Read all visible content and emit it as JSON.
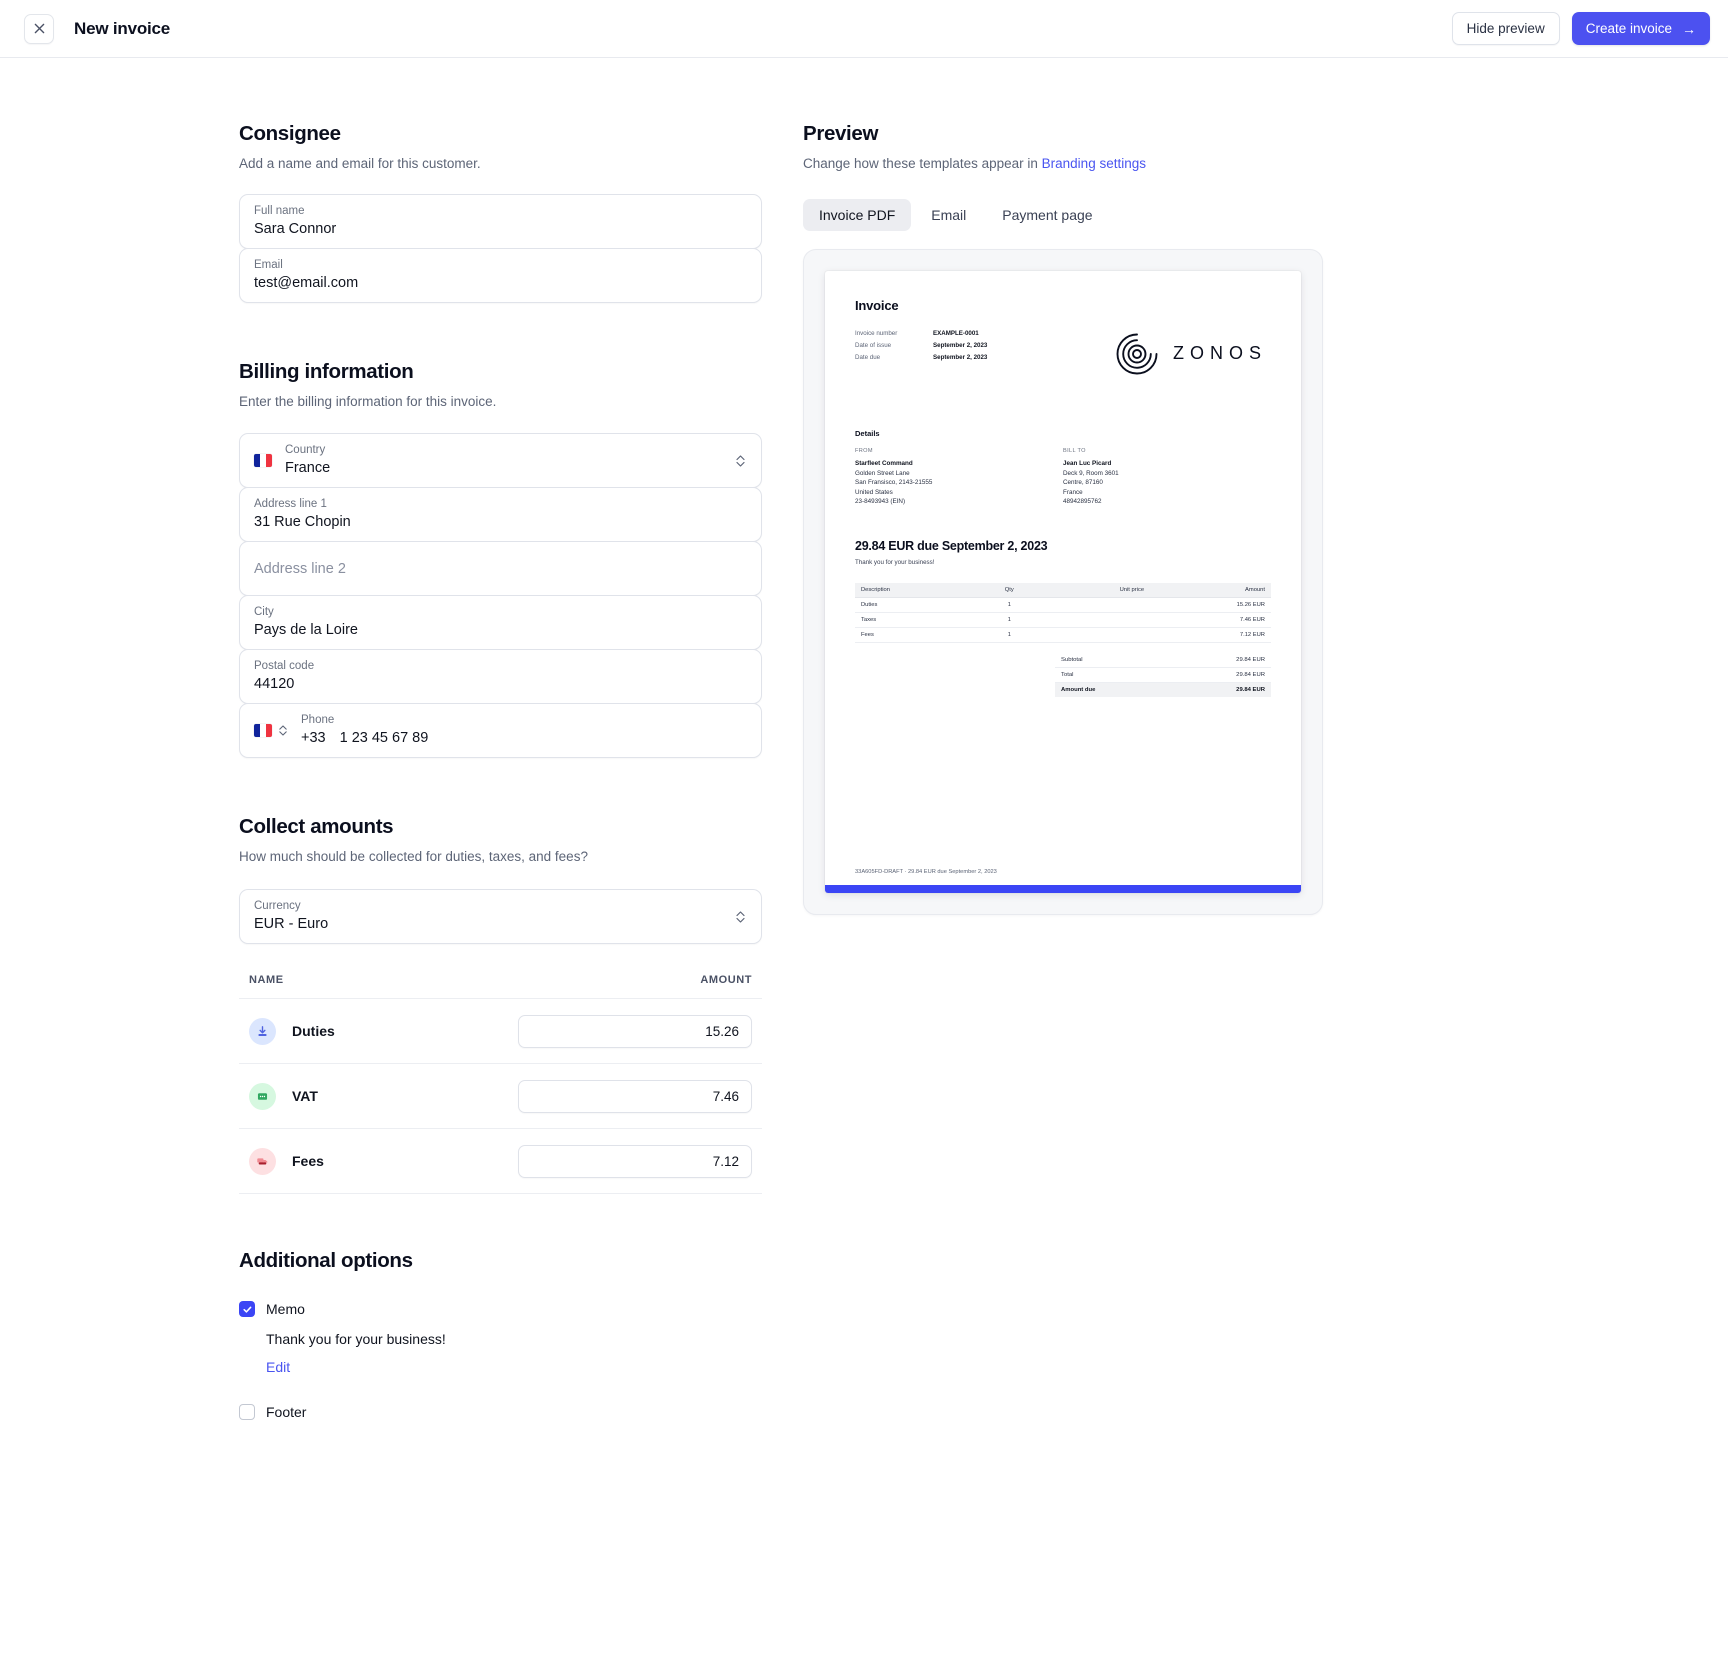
{
  "topbar": {
    "close_label": "×",
    "title": "New invoice",
    "hide_preview_label": "Hide preview",
    "create_invoice_label": "Create invoice",
    "create_invoice_arrow": "→",
    "primary_color": "#4c51f0"
  },
  "consignee": {
    "title": "Consignee",
    "subtitle": "Add a name and email for this customer.",
    "fields": [
      {
        "label": "Full name",
        "value": "Sara Connor"
      },
      {
        "label": "Email",
        "value": "test@email.com"
      }
    ]
  },
  "billing": {
    "title": "Billing information",
    "subtitle": "Enter the billing information for this invoice.",
    "country": {
      "label": "Country",
      "value": "France",
      "flag": "fr-flag-icon"
    },
    "address1": {
      "label": "Address line 1",
      "value": "31 Rue Chopin"
    },
    "address2": {
      "label": "Address line 2",
      "placeholder": "Address line 2",
      "value": ""
    },
    "city": {
      "label": "City",
      "value": "Pays de la Loire"
    },
    "postal": {
      "label": "Postal code",
      "value": "44120"
    },
    "phone": {
      "label": "Phone",
      "prefix": "+33",
      "value": "1 23 45 67 89",
      "flag": "fr-flag-icon"
    }
  },
  "collect": {
    "title": "Collect amounts",
    "subtitle": "How much should be collected for duties, taxes, and fees?",
    "currency": {
      "label": "Currency",
      "value": "EUR - Euro"
    },
    "columns": {
      "name": "NAME",
      "amount": "AMOUNT"
    },
    "rows": [
      {
        "name": "Duties",
        "amount": "15.26",
        "icon": "download-icon",
        "icon_bg": "#dbe6fe",
        "icon_fg": "#4f63e0"
      },
      {
        "name": "VAT",
        "amount": "7.46",
        "icon": "receipt-icon",
        "icon_bg": "#d6f8e0",
        "icon_fg": "#30a860"
      },
      {
        "name": "Fees",
        "amount": "7.12",
        "icon": "truck-icon",
        "icon_bg": "#fde0e2",
        "icon_fg": "#e4636f"
      }
    ]
  },
  "additional": {
    "title": "Additional options",
    "memo": {
      "label": "Memo",
      "checked": true,
      "text": "Thank you for your business!",
      "edit_label": "Edit"
    },
    "footer": {
      "label": "Footer",
      "checked": false
    }
  },
  "preview": {
    "title": "Preview",
    "subtitle_prefix": "Change how these templates appear in ",
    "subtitle_link": "Branding settings",
    "tabs": [
      {
        "label": "Invoice PDF",
        "active": true
      },
      {
        "label": "Email",
        "active": false
      },
      {
        "label": "Payment page",
        "active": false
      }
    ]
  },
  "invoice": {
    "heading": "Invoice",
    "meta": [
      {
        "key": "Invoice number",
        "value": "EXAMPLE-0001"
      },
      {
        "key": "Date of issue",
        "value": "September 2, 2023"
      },
      {
        "key": "Date due",
        "value": "September 2, 2023"
      }
    ],
    "brand": "ZONOS",
    "details_title": "Details",
    "from": {
      "header": "FROM",
      "lines": [
        "Starfleet Command",
        "Golden Street Lane",
        "San Fransisco, 2143-21555",
        "United States",
        "23-8493943 (EIN)"
      ]
    },
    "bill_to": {
      "header": "BILL TO",
      "lines": [
        "Jean Luc Picard",
        "Deck 9, Room 3601",
        "Centre, 87160",
        "France",
        "48942895762"
      ]
    },
    "due_headline": "29.84 EUR due September 2, 2023",
    "memo": "Thank you for your business!",
    "table": {
      "columns": [
        "Description",
        "Qty",
        "Unit price",
        "Amount"
      ],
      "rows": [
        {
          "description": "Duties",
          "qty": "1",
          "unit_price": "",
          "amount": "15.26 EUR"
        },
        {
          "description": "Taxes",
          "qty": "1",
          "unit_price": "",
          "amount": "7.46 EUR"
        },
        {
          "description": "Fees",
          "qty": "1",
          "unit_price": "",
          "amount": "7.12 EUR"
        }
      ]
    },
    "totals": [
      {
        "label": "Subtotal",
        "value": "29.84 EUR",
        "emphasis": false
      },
      {
        "label": "Total",
        "value": "29.84 EUR",
        "emphasis": false
      },
      {
        "label": "Amount due",
        "value": "29.84 EUR",
        "emphasis": true
      }
    ],
    "footer": "33A605FD-DRAFT · 29.84 EUR due September 2, 2023"
  }
}
